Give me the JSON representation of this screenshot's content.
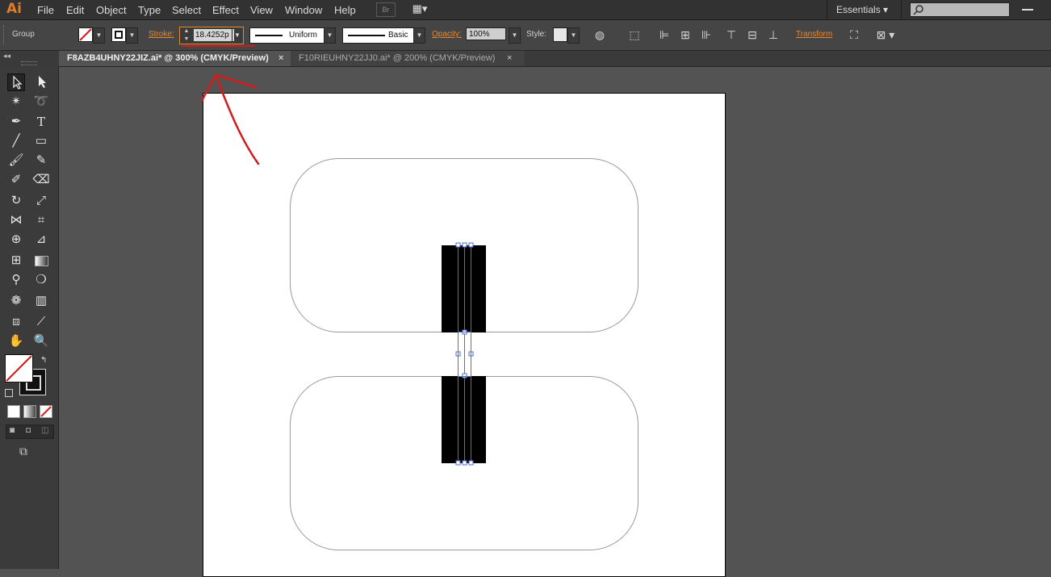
{
  "app": {
    "logo": "Ai"
  },
  "menu": [
    "File",
    "Edit",
    "Object",
    "Type",
    "Select",
    "Effect",
    "View",
    "Window",
    "Help"
  ],
  "toolbar": {
    "bridge_label": "Br"
  },
  "workspace": {
    "label": "Essentials"
  },
  "control_bar": {
    "selection_type": "Group",
    "stroke_label": "Stroke:",
    "stroke_value": "18.4252p",
    "variable_width_profile": "Uniform",
    "brush_definition": "Basic",
    "opacity_label": "Opacity:",
    "opacity_value": "100%",
    "style_label": "Style:",
    "transform_label": "Transform"
  },
  "tabs": [
    {
      "label": "F8AZB4UHNY22JIZ.ai* @ 300% (CMYK/Preview)",
      "active": true
    },
    {
      "label": "F10RIEUHNY22JJ0.ai* @ 200% (CMYK/Preview)",
      "active": false
    }
  ],
  "colors": {
    "accent_orange": "#e9892c",
    "annotation_red": "#d11c1c",
    "selection_blue": "#4f6fd6"
  },
  "tools": [
    "selection-tool",
    "direct-selection-tool",
    "magic-wand-tool",
    "lasso-tool",
    "pen-tool",
    "type-tool",
    "line-segment-tool",
    "rectangle-tool",
    "paintbrush-tool",
    "pencil-tool",
    "blob-brush-tool",
    "eraser-tool",
    "rotate-tool",
    "scale-tool",
    "width-tool",
    "free-transform-tool",
    "shape-builder-tool",
    "perspective-grid-tool",
    "mesh-tool",
    "gradient-tool",
    "eyedropper-tool",
    "blend-tool",
    "symbol-sprayer-tool",
    "column-graph-tool",
    "artboard-tool",
    "slice-tool",
    "hand-tool",
    "zoom-tool"
  ]
}
